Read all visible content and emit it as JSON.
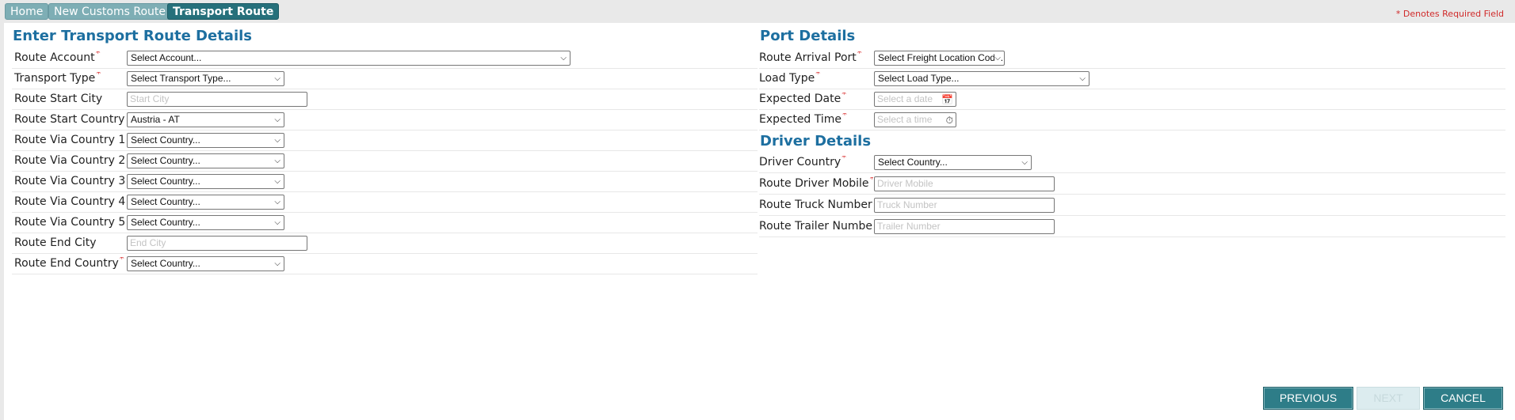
{
  "breadcrumb": [
    {
      "label": "Home"
    },
    {
      "label": "New Customs Route"
    },
    {
      "label": "Transport  Route"
    }
  ],
  "required_note": "* Denotes Required Field",
  "left_section": {
    "title": "Enter Transport Route Details",
    "fields": {
      "route_account": {
        "label": "Route Account",
        "value": "Select Account..."
      },
      "transport_type": {
        "label": "Transport Type",
        "value": "Select Transport Type..."
      },
      "route_start_city": {
        "label": "Route Start City",
        "placeholder": "Start City"
      },
      "route_start_country": {
        "label": "Route Start Country",
        "value": "Austria - AT"
      },
      "via_country_1": {
        "label": "Route Via Country 1",
        "value": "Select Country..."
      },
      "via_country_2": {
        "label": "Route Via Country 2",
        "value": "Select Country..."
      },
      "via_country_3": {
        "label": "Route Via Country 3",
        "value": "Select Country..."
      },
      "via_country_4": {
        "label": "Route Via Country 4",
        "value": "Select Country..."
      },
      "via_country_5": {
        "label": "Route Via Country 5",
        "value": "Select Country..."
      },
      "route_end_city": {
        "label": "Route End City",
        "placeholder": "End City"
      },
      "route_end_country": {
        "label": "Route End Country",
        "value": "Select Country..."
      }
    }
  },
  "port_section": {
    "title": "Port Details",
    "fields": {
      "route_arrival_port": {
        "label": "Route Arrival Port",
        "value": "Select Freight Location Code..."
      },
      "load_type": {
        "label": "Load Type",
        "value": "Select Load Type..."
      },
      "expected_date": {
        "label": "Expected Date",
        "placeholder": "Select a date",
        "icon": "calendar-icon"
      },
      "expected_time": {
        "label": "Expected Time",
        "placeholder": "Select a time",
        "icon": "clock-icon"
      }
    }
  },
  "driver_section": {
    "title": "Driver Details",
    "fields": {
      "driver_country": {
        "label": "Driver Country",
        "value": "Select Country..."
      },
      "driver_mobile": {
        "label": "Route Driver Mobile",
        "placeholder": "Driver Mobile"
      },
      "truck_number": {
        "label": "Route Truck Number",
        "placeholder": "Truck Number"
      },
      "trailer_number": {
        "label": "Route Trailer Number",
        "placeholder": "Trailer Number"
      }
    }
  },
  "buttons": {
    "previous": "PREVIOUS",
    "next": "NEXT",
    "cancel": "CANCEL"
  },
  "required_star": "*",
  "colors": {
    "title_blue": "#1d6fa0",
    "button_teal": "#2e7d88",
    "required_red": "#d62020"
  }
}
